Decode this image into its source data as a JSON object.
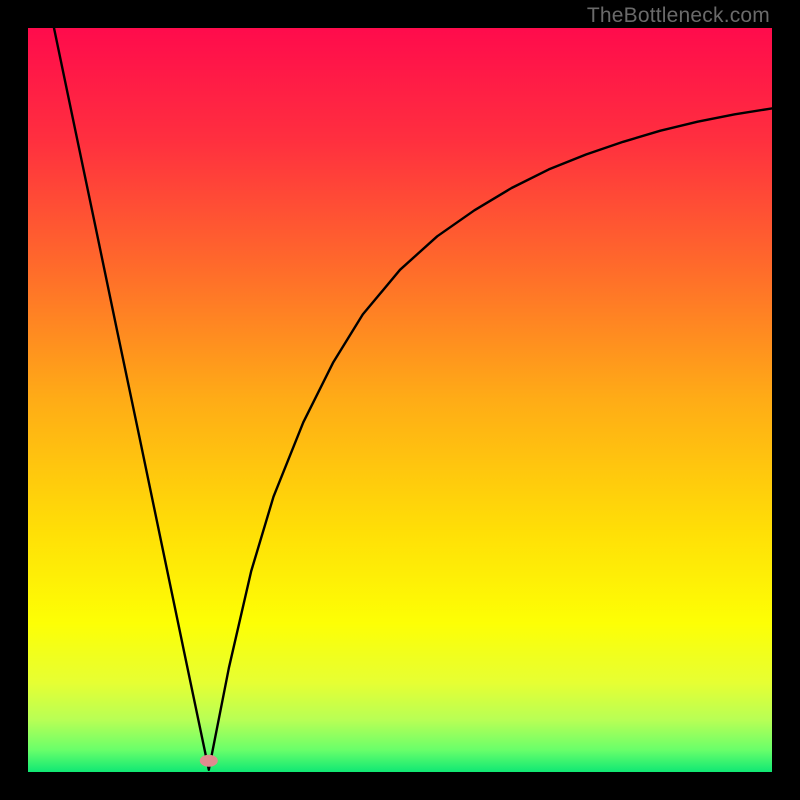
{
  "watermark": "TheBottleneck.com",
  "chart_data": {
    "type": "line",
    "title": "",
    "xlabel": "",
    "ylabel": "",
    "xlim": [
      0,
      1
    ],
    "ylim": [
      0,
      1
    ],
    "grid": false,
    "legend": false,
    "gradient_stops": [
      {
        "pos": 0.0,
        "color": "#ff0b4c"
      },
      {
        "pos": 0.15,
        "color": "#ff2f3f"
      },
      {
        "pos": 0.32,
        "color": "#ff6a2b"
      },
      {
        "pos": 0.5,
        "color": "#ffac16"
      },
      {
        "pos": 0.68,
        "color": "#ffe006"
      },
      {
        "pos": 0.8,
        "color": "#fdff05"
      },
      {
        "pos": 0.88,
        "color": "#e6ff33"
      },
      {
        "pos": 0.93,
        "color": "#b8ff55"
      },
      {
        "pos": 0.97,
        "color": "#6aff6a"
      },
      {
        "pos": 1.0,
        "color": "#10e874"
      }
    ],
    "minimum_marker": {
      "x": 0.243,
      "y": 0.015,
      "color": "#e08b8f"
    },
    "series": [
      {
        "name": "left-branch",
        "x": [
          0.035,
          0.06,
          0.09,
          0.12,
          0.15,
          0.18,
          0.21,
          0.243
        ],
        "y": [
          1.0,
          0.88,
          0.736,
          0.592,
          0.449,
          0.305,
          0.161,
          0.003
        ]
      },
      {
        "name": "right-branch",
        "x": [
          0.243,
          0.27,
          0.3,
          0.33,
          0.37,
          0.41,
          0.45,
          0.5,
          0.55,
          0.6,
          0.65,
          0.7,
          0.75,
          0.8,
          0.85,
          0.9,
          0.95,
          1.0
        ],
        "y": [
          0.003,
          0.14,
          0.27,
          0.37,
          0.47,
          0.55,
          0.615,
          0.675,
          0.72,
          0.755,
          0.785,
          0.81,
          0.83,
          0.847,
          0.862,
          0.874,
          0.884,
          0.892
        ]
      }
    ]
  }
}
